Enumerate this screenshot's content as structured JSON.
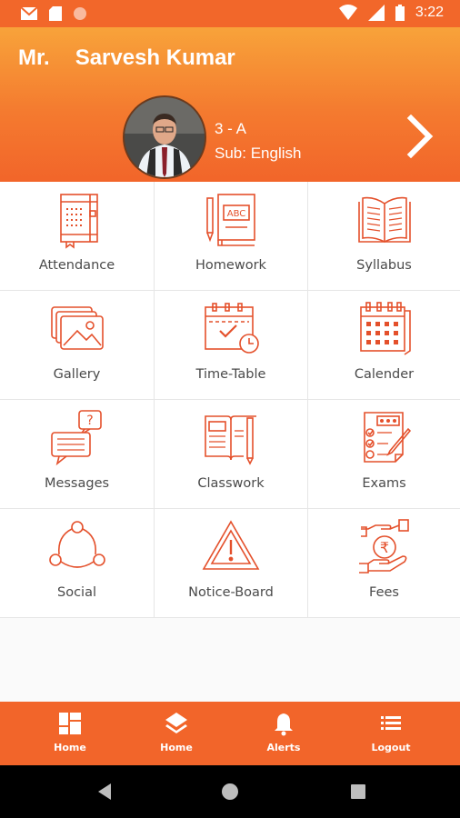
{
  "status_bar": {
    "time": "3:22",
    "icons": [
      "gmail-icon",
      "sd-card-icon",
      "circle-icon",
      "wifi-icon",
      "signal-icon",
      "battery-icon"
    ]
  },
  "profile": {
    "title": "Mr.",
    "name": "Sarvesh Kumar",
    "class": "3 - A",
    "subject": "Sub: English"
  },
  "menu": [
    {
      "label": "Attendance",
      "icon": "notebook-icon"
    },
    {
      "label": "Homework",
      "icon": "abc-book-icon"
    },
    {
      "label": "Syllabus",
      "icon": "open-book-icon"
    },
    {
      "label": "Gallery",
      "icon": "photo-gallery-icon"
    },
    {
      "label": "Time-Table",
      "icon": "calendar-clock-icon"
    },
    {
      "label": "Calender",
      "icon": "calendar-icon"
    },
    {
      "label": "Messages",
      "icon": "chat-bubbles-icon"
    },
    {
      "label": "Classwork",
      "icon": "book-pencil-icon"
    },
    {
      "label": "Exams",
      "icon": "exam-checklist-icon"
    },
    {
      "label": "Social",
      "icon": "network-icon"
    },
    {
      "label": "Notice-Board",
      "icon": "warning-triangle-icon"
    },
    {
      "label": "Fees",
      "icon": "rupee-hand-icon"
    }
  ],
  "bottom_nav": [
    {
      "label": "Home",
      "icon": "dashboard-icon"
    },
    {
      "label": "Home",
      "icon": "layers-icon"
    },
    {
      "label": "Alerts",
      "icon": "bell-icon"
    },
    {
      "label": "Logout",
      "icon": "list-icon"
    }
  ],
  "colors": {
    "primary": "#f2652a",
    "header_top": "#f8a33a",
    "icon": "#e4502b",
    "label": "#4a4a4a"
  }
}
